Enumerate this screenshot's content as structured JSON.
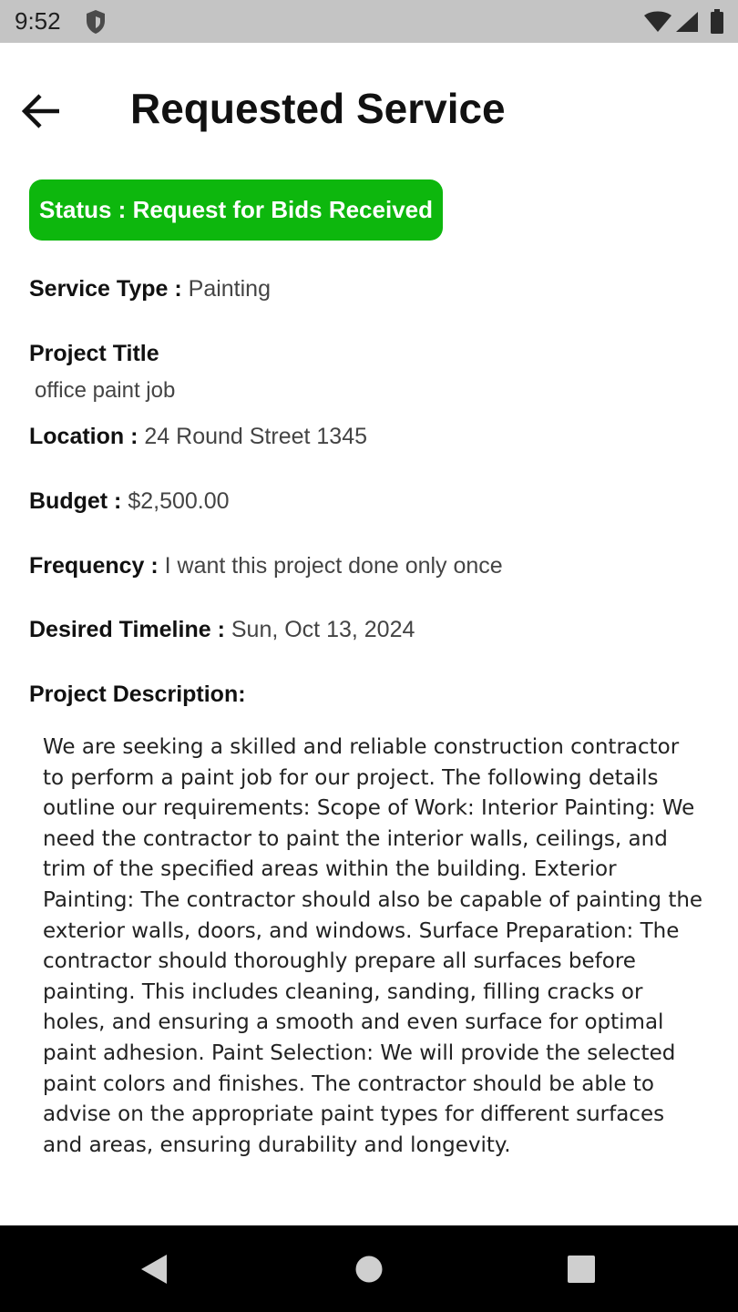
{
  "status_bar": {
    "time": "9:52",
    "icons": [
      "shield-icon",
      "wifi-icon",
      "signal-icon",
      "battery-icon"
    ]
  },
  "header": {
    "title": "Requested Service",
    "back_icon": "arrow-left-icon"
  },
  "status_badge": {
    "text": "Status : Request for Bids Received",
    "color": "#0db70d"
  },
  "details": {
    "service_type": {
      "label": "Service Type :",
      "value": "Painting"
    },
    "project_title": {
      "label": "Project Title",
      "value": "office paint job"
    },
    "location": {
      "label": "Location :",
      "value": "24 Round Street 1345"
    },
    "budget": {
      "label": "Budget :",
      "value": "$2,500.00"
    },
    "frequency": {
      "label": "Frequency :",
      "value": "I want this project done only once"
    },
    "desired_timeline": {
      "label": "Desired Timeline :",
      "value": "Sun, Oct 13, 2024"
    },
    "project_description": {
      "label": "Project Description:",
      "value": "We are seeking a skilled and reliable construction contractor to perform a paint job for our project. The following details outline our requirements: Scope of Work: Interior Painting: We need the contractor to paint the interior walls, ceilings, and trim of the specified areas within the building. Exterior Painting: The contractor should also be capable of painting the exterior walls, doors, and windows. Surface Preparation: The contractor should thoroughly prepare all surfaces before painting. This includes cleaning, sanding, filling cracks or holes, and ensuring a smooth and even surface for optimal paint adhesion. Paint Selection: We will provide the selected paint colors and finishes. The contractor should be able to advise on the appropriate paint types for different surfaces and areas, ensuring durability and longevity."
    }
  },
  "nav_bar": {
    "icons": [
      "nav-back-icon",
      "nav-home-icon",
      "nav-recents-icon"
    ]
  }
}
